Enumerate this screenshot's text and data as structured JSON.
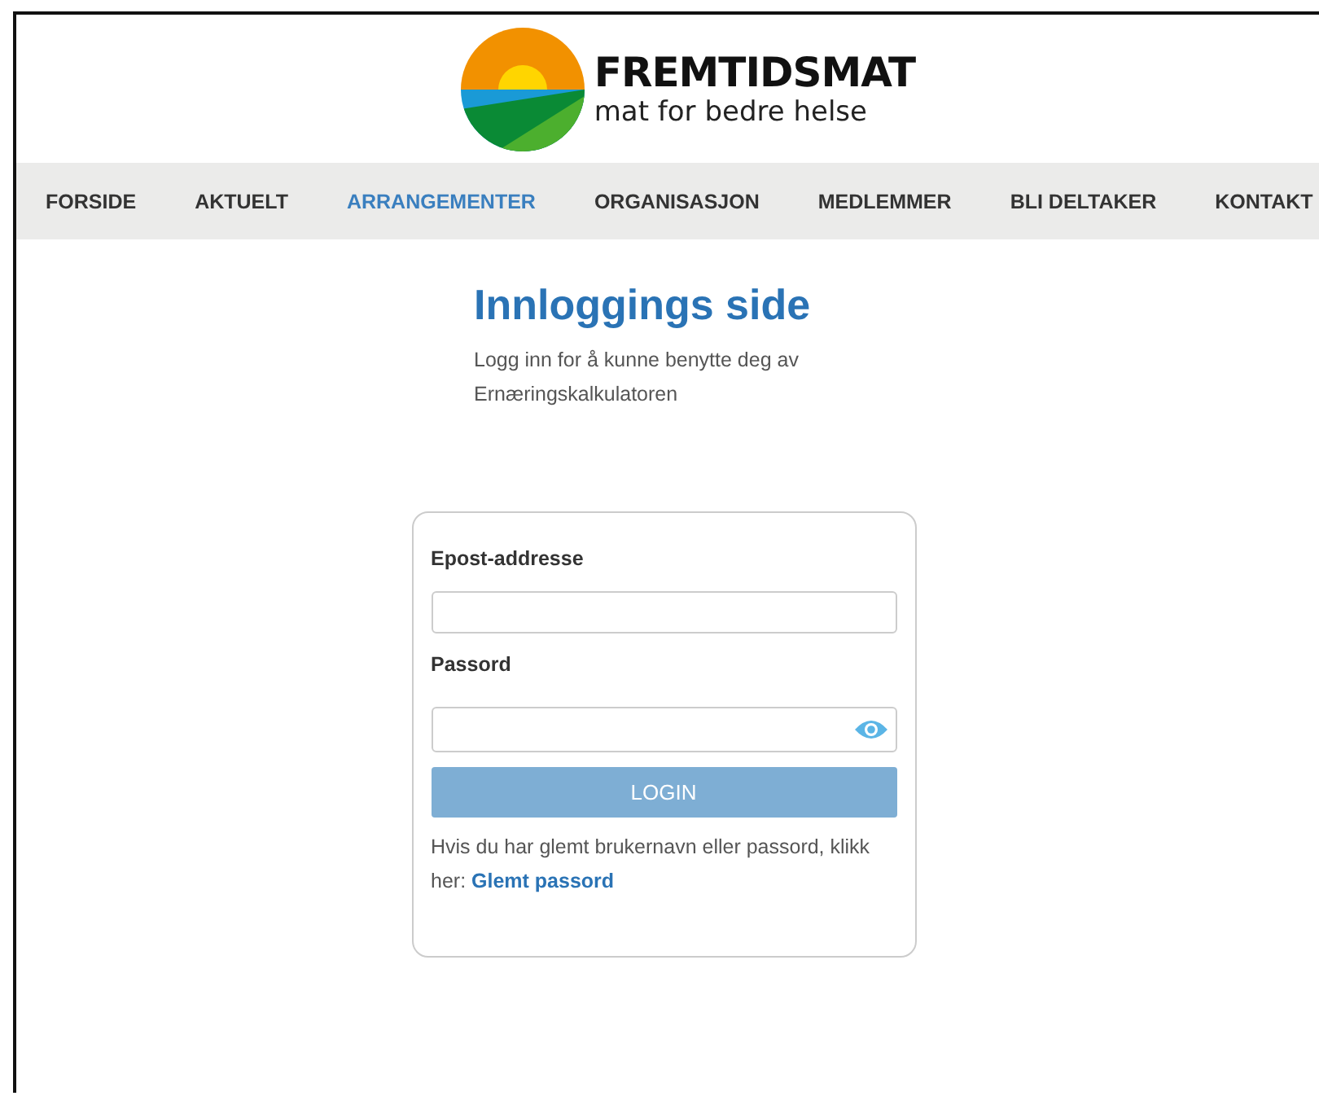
{
  "logo": {
    "name": "FREMTIDSMAT",
    "tagline": "mat for bedre helse"
  },
  "nav": [
    {
      "label": "FORSIDE",
      "selected": false
    },
    {
      "label": "AKTUELT",
      "selected": false
    },
    {
      "label": "ARRANGEMENTER",
      "selected": true
    },
    {
      "label": "ORGANISASJON",
      "selected": false
    },
    {
      "label": "MEDLEMMER",
      "selected": false
    },
    {
      "label": "BLI DELTAKER",
      "selected": false
    },
    {
      "label": "KONTAKT",
      "selected": false
    }
  ],
  "page": {
    "title": "Innloggings side",
    "intro": "Logg inn for å kunne benytte deg av Ernæringskalkulatoren"
  },
  "form": {
    "email_label": "Epost-addresse",
    "password_label": "Passord",
    "login_button": {
      "label": "LOGIN",
      "disabled": true
    },
    "help_text": "Hvis du har glemt brukernavn eller passord, klikk her:",
    "help_link": "Glemt passord"
  }
}
